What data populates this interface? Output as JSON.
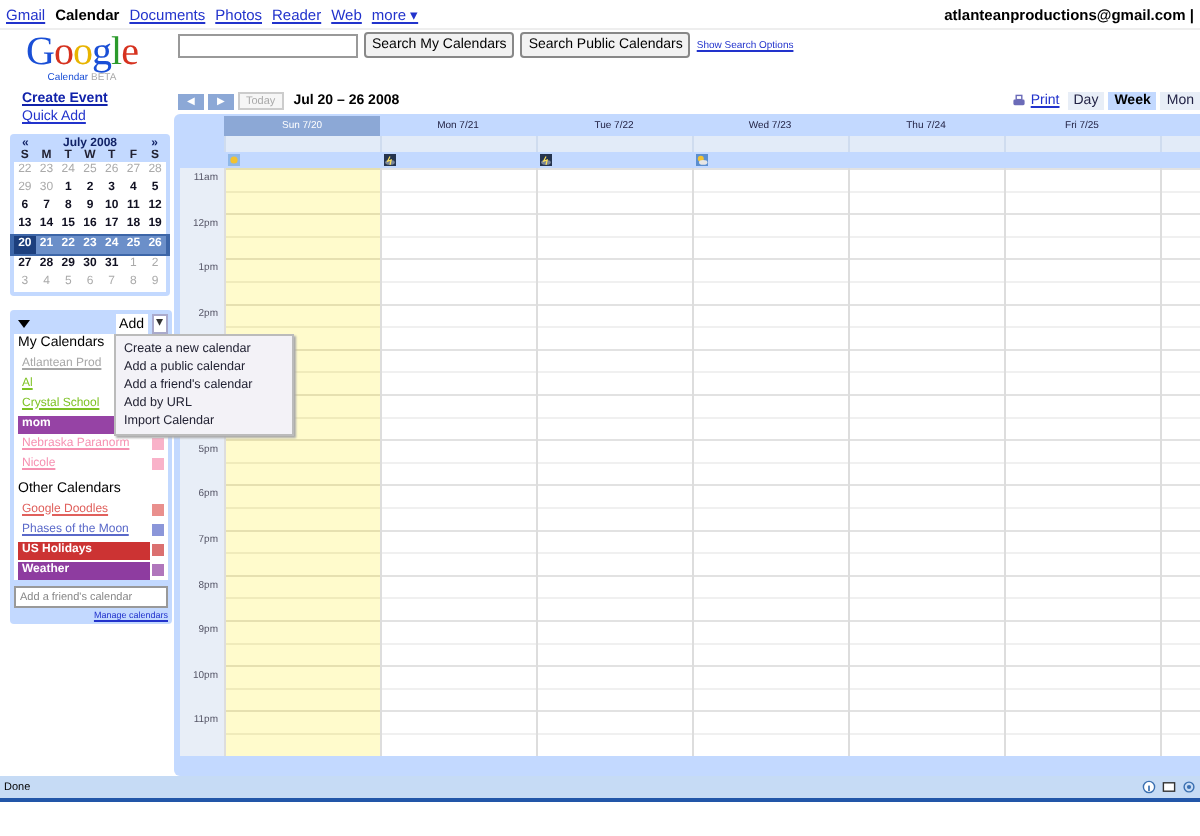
{
  "top_nav": {
    "links": [
      {
        "label": "Gmail",
        "selected": false
      },
      {
        "label": "Calendar",
        "selected": true
      },
      {
        "label": "Documents",
        "selected": false
      },
      {
        "label": "Photos",
        "selected": false
      },
      {
        "label": "Reader",
        "selected": false
      },
      {
        "label": "Web",
        "selected": false
      },
      {
        "label": "more ▾",
        "selected": false
      }
    ],
    "account": "atlanteanproductions@gmail.com |"
  },
  "logo": {
    "word": "Google",
    "product": "Calendar",
    "badge": "BETA"
  },
  "search": {
    "buttons": [
      "Search My Calendars",
      "Search Public Calendars"
    ],
    "options_link": "Show Search Options"
  },
  "sidebar": {
    "create_event": "Create Event",
    "quick_add": "Quick Add",
    "mini_calendar": {
      "prev": "«",
      "next": "»",
      "title": "July 2008",
      "weekdays": [
        "S",
        "M",
        "T",
        "W",
        "T",
        "F",
        "S"
      ],
      "weeks": [
        {
          "selected": false,
          "days": [
            {
              "d": "22",
              "muted": true
            },
            {
              "d": "23",
              "muted": true
            },
            {
              "d": "24",
              "muted": true
            },
            {
              "d": "25",
              "muted": true
            },
            {
              "d": "26",
              "muted": true
            },
            {
              "d": "27",
              "muted": true
            },
            {
              "d": "28",
              "muted": true
            }
          ]
        },
        {
          "selected": false,
          "days": [
            {
              "d": "29",
              "muted": true
            },
            {
              "d": "30",
              "muted": true
            },
            {
              "d": "1",
              "muted": false
            },
            {
              "d": "2",
              "muted": false
            },
            {
              "d": "3",
              "muted": false
            },
            {
              "d": "4",
              "muted": false
            },
            {
              "d": "5",
              "muted": false
            }
          ]
        },
        {
          "selected": false,
          "days": [
            {
              "d": "6",
              "muted": false
            },
            {
              "d": "7",
              "muted": false
            },
            {
              "d": "8",
              "muted": false
            },
            {
              "d": "9",
              "muted": false
            },
            {
              "d": "10",
              "muted": false
            },
            {
              "d": "11",
              "muted": false
            },
            {
              "d": "12",
              "muted": false
            }
          ]
        },
        {
          "selected": false,
          "days": [
            {
              "d": "13",
              "muted": false
            },
            {
              "d": "14",
              "muted": false
            },
            {
              "d": "15",
              "muted": false
            },
            {
              "d": "16",
              "muted": false
            },
            {
              "d": "17",
              "muted": false
            },
            {
              "d": "18",
              "muted": false
            },
            {
              "d": "19",
              "muted": false
            }
          ]
        },
        {
          "selected": true,
          "days": [
            {
              "d": "20",
              "muted": false
            },
            {
              "d": "21",
              "muted": false
            },
            {
              "d": "22",
              "muted": false
            },
            {
              "d": "23",
              "muted": false
            },
            {
              "d": "24",
              "muted": false
            },
            {
              "d": "25",
              "muted": false
            },
            {
              "d": "26",
              "muted": false
            }
          ]
        },
        {
          "selected": false,
          "days": [
            {
              "d": "27",
              "muted": false
            },
            {
              "d": "28",
              "muted": false
            },
            {
              "d": "29",
              "muted": false
            },
            {
              "d": "30",
              "muted": false
            },
            {
              "d": "31",
              "muted": false
            },
            {
              "d": "1",
              "muted": true
            },
            {
              "d": "2",
              "muted": true
            }
          ]
        },
        {
          "selected": false,
          "days": [
            {
              "d": "3",
              "muted": true
            },
            {
              "d": "4",
              "muted": true
            },
            {
              "d": "5",
              "muted": true
            },
            {
              "d": "6",
              "muted": true
            },
            {
              "d": "7",
              "muted": true
            },
            {
              "d": "8",
              "muted": true
            },
            {
              "d": "9",
              "muted": true
            }
          ]
        }
      ]
    },
    "add_button": "Add",
    "add_caret": "▾",
    "my_calendars_title": "My Calendars",
    "my_calendars": [
      {
        "name": "Atlantean Prod",
        "color": "#a7a7a7",
        "shown": false
      },
      {
        "name": "Al",
        "color": "#7ec225",
        "shown": false
      },
      {
        "name": "Crystal School",
        "color": "#7ec225",
        "shown": false
      },
      {
        "name": "mom",
        "color": "#9643a5",
        "shown": true
      },
      {
        "name": "Nebraska Paranorm",
        "color": "#f691b2",
        "shown": false,
        "menu_icon": true
      },
      {
        "name": "Nicole",
        "color": "#f691b2",
        "shown": false,
        "menu_icon": true
      }
    ],
    "other_calendars_title": "Other Calendars",
    "other_calendars": [
      {
        "name": "Google Doodles",
        "color": "#e0605c",
        "shown": false
      },
      {
        "name": "Phases of the Moon",
        "color": "#5a69c9",
        "shown": false
      },
      {
        "name": "US Holidays",
        "color": "#cc3333",
        "shown": true
      },
      {
        "name": "Weather",
        "color": "#8e3ca0",
        "shown": true
      }
    ],
    "friend_field": {
      "placeholder": "Add a friend's calendar"
    },
    "manage_link": "Manage calendars"
  },
  "add_menu": [
    "Create a new calendar",
    "Add a public calendar",
    "Add a friend's calendar",
    "Add by URL",
    "Import Calendar"
  ],
  "toolbar": {
    "prev": "◀",
    "next": "▶",
    "today": "Today",
    "range": "Jul 20 – 26 2008",
    "print": "Print",
    "views": [
      {
        "label": "Day",
        "selected": false
      },
      {
        "label": "Week",
        "selected": true
      },
      {
        "label": "Mon",
        "selected": false
      }
    ]
  },
  "days": [
    {
      "label": "Sun 7/20",
      "today": true,
      "weather": {
        "kind": "sunny"
      }
    },
    {
      "label": "Mon 7/21",
      "today": false,
      "weather": {
        "kind": "storm"
      }
    },
    {
      "label": "Tue 7/22",
      "today": false,
      "weather": {
        "kind": "storm"
      }
    },
    {
      "label": "Wed 7/23",
      "today": false,
      "weather": {
        "kind": "partly"
      }
    },
    {
      "label": "Thu 7/24",
      "today": false
    },
    {
      "label": "Fri 7/25",
      "today": false
    }
  ],
  "hour_labels": {
    "upper": [
      "11am",
      "12pm",
      "1pm",
      "2pm"
    ],
    "lower": [
      "5pm",
      "6pm",
      "7pm",
      "8pm",
      "9pm",
      "10pm",
      "11pm"
    ]
  },
  "status_bar": {
    "text": "Done"
  }
}
